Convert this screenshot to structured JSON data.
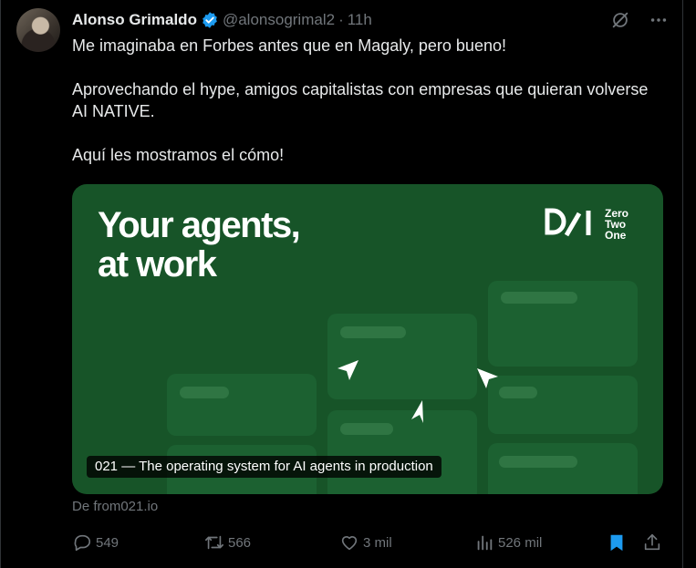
{
  "author": {
    "name": "Alonso Grimaldo",
    "handle": "@alonsogrimal2",
    "separator": "·",
    "time": "11h"
  },
  "tweet": {
    "paragraphs": [
      "Me imaginaba en Forbes antes que en Magaly, pero bueno!",
      "Aprovechando el hype, amigos capitalistas con empresas que quieran volverse AI NATIVE.",
      "Aquí les mostramos el cómo!"
    ]
  },
  "card": {
    "headline_line1": "Your agents,",
    "headline_line2": "at work",
    "brand_line1": "Zero",
    "brand_line2": "Two",
    "brand_line3": "One",
    "caption": "021 — The operating system for AI agents in production",
    "source": "De from021.io"
  },
  "actions": {
    "replies": "549",
    "reposts": "566",
    "likes": "3 mil",
    "views": "526 mil"
  },
  "colors": {
    "accent": "#1d9bf0",
    "card_bg": "#175428",
    "muted": "#71767b"
  },
  "icons": [
    "verified-icon",
    "grok-icon",
    "more-icon",
    "reply-icon",
    "repost-icon",
    "like-icon",
    "views-icon",
    "bookmark-icon",
    "share-icon"
  ]
}
